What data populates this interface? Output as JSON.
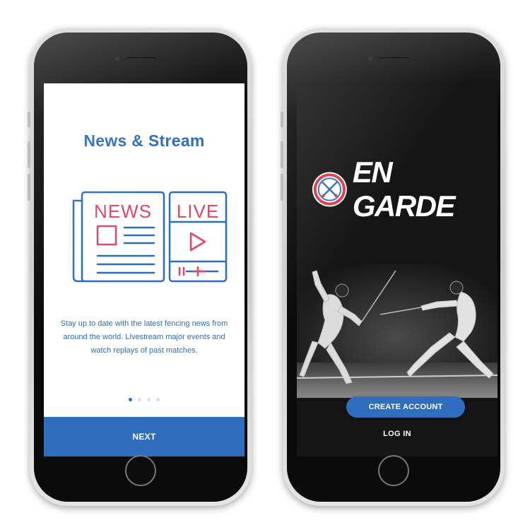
{
  "left_screen": {
    "title": "News & Stream",
    "illustration": {
      "news_label": "NEWS",
      "live_label": "LIVE"
    },
    "description": "Stay up to date with the latest fencing news from around the world. Livestream major events and watch replays of past matches.",
    "pagination": {
      "total": 4,
      "active_index": 0
    },
    "next_label": "NEXT"
  },
  "right_screen": {
    "logo_text": "EN GARDE",
    "create_account_label": "CREATE ACCOUNT",
    "login_label": "LOG IN"
  },
  "colors": {
    "brand_blue": "#2f6dbf",
    "accent_red": "#e04868",
    "dark_bg": "#151515"
  },
  "icons": [
    "newspaper-icon",
    "live-stream-icon",
    "play-icon",
    "crossed-swords-logo-icon"
  ]
}
